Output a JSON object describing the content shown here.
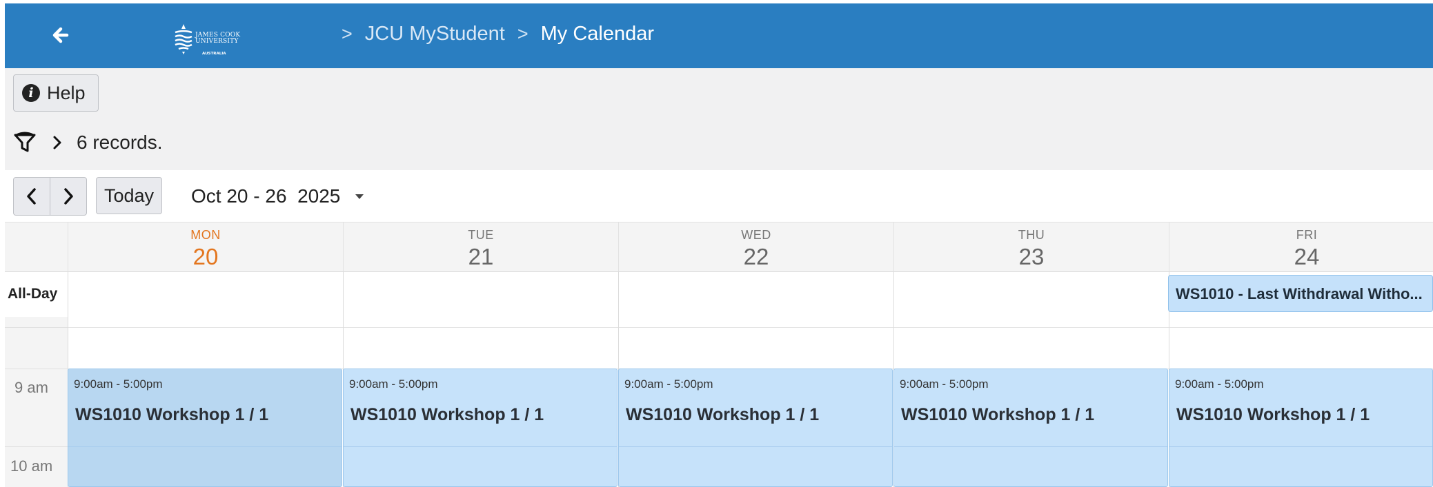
{
  "header": {
    "logo_text_line1": "JAMES COOK",
    "logo_text_line2": "UNIVERSITY",
    "logo_text_line3": "AUSTRALIA",
    "breadcrumbs": [
      {
        "label": "JCU MyStudent"
      },
      {
        "label": "My Calendar"
      }
    ],
    "separator": ">",
    "color": "#2a7ec1"
  },
  "toolbar": {
    "help_label": "Help",
    "records_text": "6 records."
  },
  "nav": {
    "today_label": "Today",
    "date_range": "Oct 20 - 26  2025"
  },
  "days": [
    {
      "name": "MON",
      "date": "20",
      "today": true
    },
    {
      "name": "TUE",
      "date": "21"
    },
    {
      "name": "WED",
      "date": "22"
    },
    {
      "name": "THU",
      "date": "23"
    },
    {
      "name": "FRI",
      "date": "24"
    }
  ],
  "allday": {
    "label": "All-Day",
    "event": "WS1010 - Last Withdrawal Witho..."
  },
  "time_labels": [
    "9 am",
    "10 am"
  ],
  "events": [
    {
      "time": "9:00am - 5:00pm",
      "title": "WS1010 Workshop 1 / 1"
    },
    {
      "time": "9:00am - 5:00pm",
      "title": "WS1010 Workshop 1 / 1"
    },
    {
      "time": "9:00am - 5:00pm",
      "title": "WS1010 Workshop 1 / 1"
    },
    {
      "time": "9:00am - 5:00pm",
      "title": "WS1010 Workshop 1 / 1"
    },
    {
      "time": "9:00am - 5:00pm",
      "title": "WS1010 Workshop 1 / 1"
    }
  ],
  "colors": {
    "accent_today": "#e3761f",
    "event_fill": "#c6e2fa",
    "event_border": "#9cc7ec"
  }
}
